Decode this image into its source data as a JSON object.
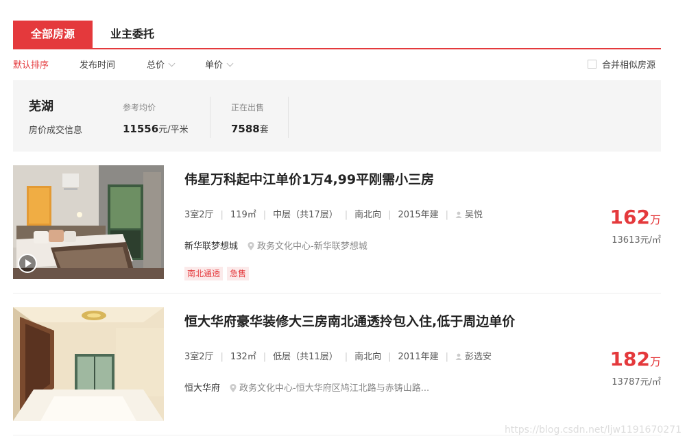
{
  "tabs": {
    "all": "全部房源",
    "owner": "业主委托"
  },
  "sort": {
    "default": "默认排序",
    "time": "发布时间",
    "total": "总价",
    "unit": "单价",
    "merge": "合并相似房源"
  },
  "stats": {
    "city": "芜湖",
    "city_link": "房价成交信息",
    "avg_label": "参考均价",
    "avg_value": "11556",
    "avg_unit": "元/平米",
    "sale_label": "正在出售",
    "sale_value": "7588",
    "sale_unit": "套"
  },
  "listings": [
    {
      "title": "伟星万科起中江单价1万4,99平刚需小三房",
      "layout": "3室2厅",
      "area": "119㎡",
      "floor": "中层（共17层）",
      "orientation": "南北向",
      "year": "2015年建",
      "agent": "吴悦",
      "community": "新华联梦想城",
      "address": "政务文化中心-新华联梦想城",
      "tags": [
        "南北通透",
        "急售"
      ],
      "price": "162",
      "price_unit": "万",
      "unit_price": "13613元/㎡"
    },
    {
      "title": "恒大华府豪华装修大三房南北通透拎包入住,低于周边单价",
      "layout": "3室2厅",
      "area": "132㎡",
      "floor": "低层（共11层）",
      "orientation": "南北向",
      "year": "2011年建",
      "agent": "彭选安",
      "community": "恒大华府",
      "address": "政务文化中心-恒大华府区鸠江北路与赤铸山路...",
      "tags": [],
      "price": "182",
      "price_unit": "万",
      "unit_price": "13787元/㎡"
    }
  ],
  "watermark": "https://blog.csdn.net/ljw1191670271"
}
